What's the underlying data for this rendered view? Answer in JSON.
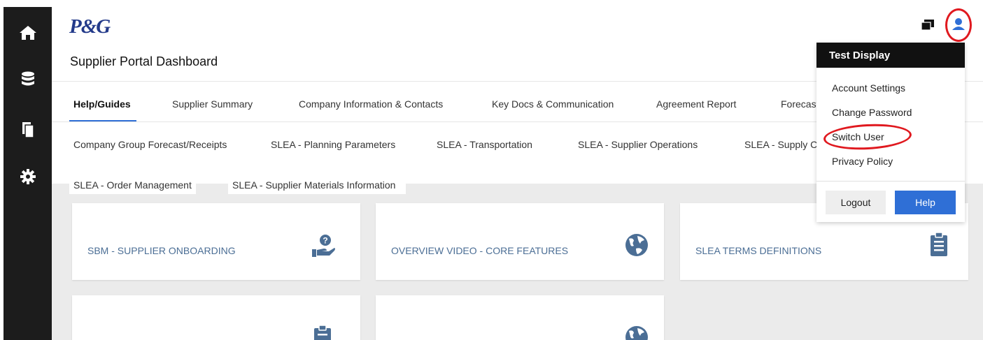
{
  "app": {
    "logo": "P&G",
    "page_title": "Supplier Portal Dashboard"
  },
  "rail": {
    "items": [
      "home-icon",
      "database-icon",
      "documents-icon",
      "gear-icon"
    ]
  },
  "header": {
    "icons": [
      "window-stack-icon",
      "user-icon"
    ]
  },
  "tabs": {
    "row1": [
      "Help/Guides",
      "Supplier Summary",
      "Company Information & Contacts",
      "Key Docs & Communication",
      "Agreement Report",
      "Forecast"
    ],
    "row2": [
      "Company Group Forecast/Receipts",
      "SLEA - Planning Parameters",
      "SLEA - Transportation",
      "SLEA -  Supplier Operations",
      "SLEA - Supply Ch"
    ],
    "row3": [
      "SLEA - Order Management",
      "SLEA - Supplier Materials Information"
    ],
    "active": "Help/Guides"
  },
  "cards": [
    {
      "label": "SBM - SUPPLIER ONBOARDING",
      "icon": "hand-question-icon"
    },
    {
      "label": "OVERVIEW VIDEO - CORE FEATURES",
      "icon": "globe-icon"
    },
    {
      "label": "SLEA TERMS DEFINITIONS",
      "icon": "clipboard-icon"
    },
    {
      "label": "",
      "icon": "clipboard-icon"
    },
    {
      "label": "",
      "icon": "globe-icon"
    }
  ],
  "user_menu": {
    "title": "Test Display",
    "items": [
      "Account Settings",
      "Change Password",
      "Switch User",
      "Privacy Policy"
    ],
    "logout": "Logout",
    "help": "Help"
  },
  "colors": {
    "accent": "#2f6fd6",
    "rail": "#1c1c1c",
    "brand": "#233a8a",
    "card_text": "#4b6e95",
    "icon": "#4b6e95",
    "annotation": "#e0191f"
  }
}
